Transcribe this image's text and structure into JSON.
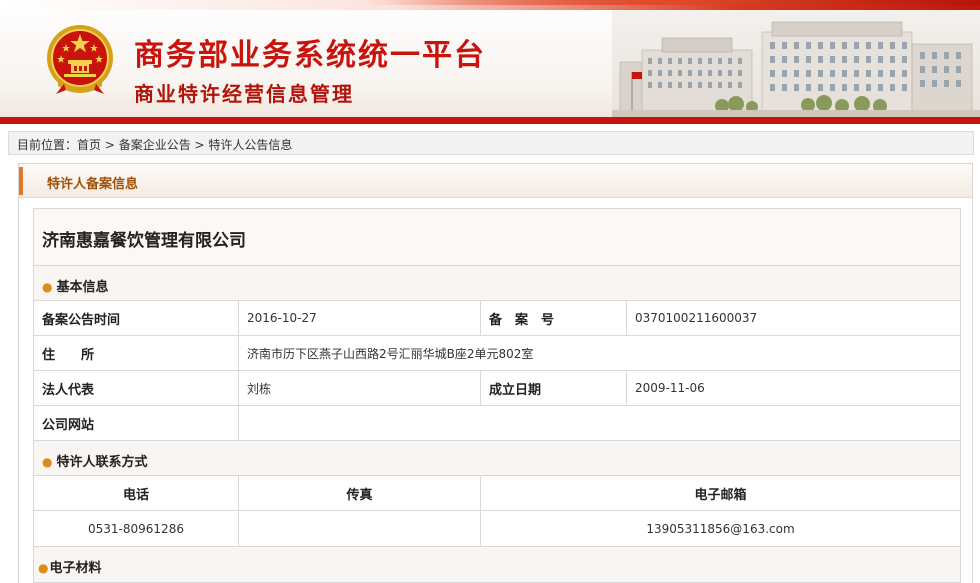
{
  "header": {
    "system_title": "商务部业务系统统一平台",
    "system_subtitle": "商业特许经营信息管理"
  },
  "breadcrumb": {
    "prefix": "目前位置：",
    "items": [
      "首页",
      "备案企业公告",
      "特许人公告信息"
    ],
    "separator": " > "
  },
  "panel": {
    "title": "特许人备案信息"
  },
  "company": {
    "name": "济南惠嘉餐饮管理有限公司"
  },
  "basic_info": {
    "section_title": "基本信息",
    "announce_time_label": "备案公告时间",
    "announce_time_value": "2016-10-27",
    "record_no_label": "备　案　号",
    "record_no_value": "0370100211600037",
    "address_label": "住　　所",
    "address_value": "济南市历下区燕子山西路2号汇丽华城B座2单元802室",
    "legal_rep_label": "法人代表",
    "legal_rep_value": "刘栋",
    "established_label": "成立日期",
    "established_value": "2009-11-06",
    "website_label": "公司网站",
    "website_value": ""
  },
  "contact": {
    "section_title": "特许人联系方式",
    "columns": [
      "电话",
      "传真",
      "电子邮箱"
    ],
    "values": [
      "0531-80961286",
      "",
      "13905311856@163.com"
    ]
  },
  "materials": {
    "section_title": "电子材料"
  },
  "colors": {
    "brand_red": "#c8140c",
    "accent_orange": "#e07a2a",
    "panel_title": "#a0520a"
  }
}
